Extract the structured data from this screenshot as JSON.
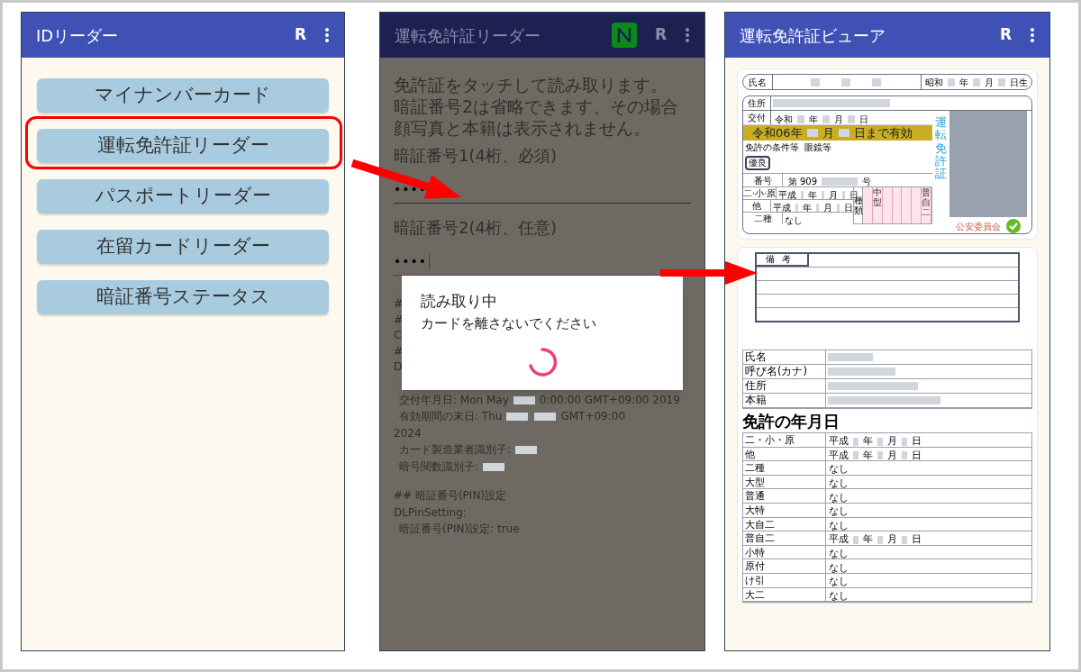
{
  "menu_screen": {
    "title": "IDリーダー",
    "action": "R",
    "buttons": [
      {
        "label": "マイナンバーカード",
        "highlighted": false
      },
      {
        "label": "運転免許証リーダー",
        "highlighted": true
      },
      {
        "label": "パスポートリーダー",
        "highlighted": false
      },
      {
        "label": "在留カードリーダー",
        "highlighted": false
      },
      {
        "label": "暗証番号ステータス",
        "highlighted": false
      }
    ]
  },
  "reader_screen": {
    "title": "運転免許証リーダー",
    "action": "R",
    "nfc_on": true,
    "instructions": [
      "免許証をタッチして読み取ります。",
      "暗証番号2は省略できます、その場合",
      "顔写真と本籍は表示されません。"
    ],
    "fields": [
      {
        "label": "暗証番号1(4桁、必須)",
        "value": "••••",
        "focused": false
      },
      {
        "label": "暗証番号2(4桁、任意)",
        "value": "••••",
        "focused": true
      }
    ],
    "log_fragments": [
      "#",
      "#",
      "C",
      "#",
      "D"
    ],
    "log": [
      {
        "kind": "entry",
        "segments": [
          {
            "kind": "text",
            "text": "交付年月日: Mon May"
          },
          {
            "kind": "redacted"
          },
          {
            "kind": "text",
            "text": "0:00:00 GMT+09:00 2019"
          }
        ]
      },
      {
        "kind": "entry",
        "segments": [
          {
            "kind": "text",
            "text": "有効期間の末日: Thu"
          },
          {
            "kind": "redacted"
          },
          {
            "kind": "redacted"
          },
          {
            "kind": "text",
            "text": "GMT+09:00"
          }
        ]
      },
      {
        "kind": "plain",
        "segments": [
          {
            "kind": "text",
            "text": "2024"
          }
        ]
      },
      {
        "kind": "entry",
        "segments": [
          {
            "kind": "text",
            "text": "カード製造業者識別子:"
          },
          {
            "kind": "redacted"
          }
        ]
      },
      {
        "kind": "entry",
        "segments": [
          {
            "kind": "text",
            "text": "暗号関数識別子:"
          },
          {
            "kind": "redacted"
          }
        ]
      },
      {
        "kind": "heading",
        "segments": [
          {
            "kind": "text",
            "text": "## 暗証番号(PIN)設定"
          }
        ]
      },
      {
        "kind": "plain",
        "segments": [
          {
            "kind": "text",
            "text": "DLPinSetting:"
          }
        ]
      },
      {
        "kind": "entry",
        "segments": [
          {
            "kind": "text",
            "text": "暗証番号(PIN)設定: true"
          }
        ]
      }
    ],
    "dialog": {
      "title": "読み取り中",
      "message": "カードを離さないでください"
    }
  },
  "viewer_screen": {
    "title": "運転免許証ビューア",
    "action": "R",
    "license_card": {
      "name_label": "氏名",
      "birth": [
        {
          "kind": "text",
          "text": "昭和"
        },
        {
          "kind": "redacted"
        },
        {
          "kind": "text",
          "text": "年"
        },
        {
          "kind": "redacted"
        },
        {
          "kind": "text",
          "text": "月"
        },
        {
          "kind": "redacted"
        },
        {
          "kind": "text",
          "text": "日生"
        }
      ],
      "address_label": "住所",
      "issue_label": "交付",
      "issue_value": [
        {
          "kind": "text",
          "text": "令和"
        },
        {
          "kind": "redacted"
        },
        {
          "kind": "text",
          "text": "年"
        },
        {
          "kind": "redacted"
        },
        {
          "kind": "text",
          "text": "月"
        },
        {
          "kind": "redacted"
        },
        {
          "kind": "text",
          "text": "日"
        }
      ],
      "validity": [
        {
          "kind": "text",
          "text": "令和06年"
        },
        {
          "kind": "redacted"
        },
        {
          "kind": "text",
          "text": "月"
        },
        {
          "kind": "redacted"
        },
        {
          "kind": "text",
          "text": "日まで有効"
        }
      ],
      "conditions_label": "免許の条件等",
      "conditions_value": "眼鏡等",
      "badge": "優良",
      "number_label": "番号",
      "number_value": [
        {
          "kind": "text",
          "text": "第"
        },
        {
          "kind": "text",
          "text": "909"
        },
        {
          "kind": "redacted"
        },
        {
          "kind": "text",
          "text": "号"
        }
      ],
      "dates": [
        {
          "label": "二·小·原",
          "value": [
            {
              "kind": "text",
              "text": "平成"
            },
            {
              "kind": "redacted"
            },
            {
              "kind": "text",
              "text": "年"
            },
            {
              "kind": "redacted"
            },
            {
              "kind": "text",
              "text": "月"
            },
            {
              "kind": "redacted"
            },
            {
              "kind": "text",
              "text": "日"
            }
          ]
        },
        {
          "label": "他",
          "value": [
            {
              "kind": "text",
              "text": "平成"
            },
            {
              "kind": "redacted"
            },
            {
              "kind": "text",
              "text": "年"
            },
            {
              "kind": "redacted"
            },
            {
              "kind": "text",
              "text": "月"
            },
            {
              "kind": "redacted"
            },
            {
              "kind": "text",
              "text": "日"
            }
          ]
        },
        {
          "label": "二種",
          "value": [
            {
              "kind": "text",
              "text": "なし"
            }
          ]
        }
      ],
      "class_label": "種類",
      "class_columns": [
        {
          "kind": "blank"
        },
        {
          "kind": "labelled",
          "label": "中型"
        },
        {
          "kind": "blank"
        },
        {
          "kind": "blank"
        },
        {
          "kind": "blank"
        },
        {
          "kind": "blank"
        },
        {
          "kind": "labelled",
          "label": "普自二"
        }
      ],
      "card_type": "運転免許証",
      "authority": "公安委員会",
      "verified": true
    },
    "remarks": {
      "label": "備考"
    },
    "personal_table": [
      {
        "label": "氏名"
      },
      {
        "label": "呼び名(カナ)"
      },
      {
        "label": "住所"
      },
      {
        "label": "本籍"
      }
    ],
    "dates_heading": "免許の年月日",
    "dates_table": [
      {
        "label": "二・小・原",
        "value": [
          {
            "kind": "text",
            "text": "平成"
          },
          {
            "kind": "redacted"
          },
          {
            "kind": "text",
            "text": "年"
          },
          {
            "kind": "redacted"
          },
          {
            "kind": "text",
            "text": "月"
          },
          {
            "kind": "redacted"
          },
          {
            "kind": "text",
            "text": "日"
          }
        ]
      },
      {
        "label": "他",
        "value": [
          {
            "kind": "text",
            "text": "平成"
          },
          {
            "kind": "redacted"
          },
          {
            "kind": "text",
            "text": "年"
          },
          {
            "kind": "redacted"
          },
          {
            "kind": "text",
            "text": "月"
          },
          {
            "kind": "redacted"
          },
          {
            "kind": "text",
            "text": "日"
          }
        ]
      },
      {
        "label": "二種",
        "value": [
          {
            "kind": "text",
            "text": "なし"
          }
        ]
      },
      {
        "label": "大型",
        "value": [
          {
            "kind": "text",
            "text": "なし"
          }
        ]
      },
      {
        "label": "普通",
        "value": [
          {
            "kind": "text",
            "text": "なし"
          }
        ]
      },
      {
        "label": "大特",
        "value": [
          {
            "kind": "text",
            "text": "なし"
          }
        ]
      },
      {
        "label": "大自二",
        "value": [
          {
            "kind": "text",
            "text": "なし"
          }
        ]
      },
      {
        "label": "普自二",
        "value": [
          {
            "kind": "text",
            "text": "平成"
          },
          {
            "kind": "redacted"
          },
          {
            "kind": "text",
            "text": "年"
          },
          {
            "kind": "redacted"
          },
          {
            "kind": "text",
            "text": "月"
          },
          {
            "kind": "redacted"
          },
          {
            "kind": "text",
            "text": "日"
          }
        ]
      },
      {
        "label": "小特",
        "value": [
          {
            "kind": "text",
            "text": "なし"
          }
        ]
      },
      {
        "label": "原付",
        "value": [
          {
            "kind": "text",
            "text": "なし"
          }
        ]
      },
      {
        "label": "け引",
        "value": [
          {
            "kind": "text",
            "text": "なし"
          }
        ]
      },
      {
        "label": "大二",
        "value": [
          {
            "kind": "text",
            "text": "なし"
          }
        ]
      }
    ]
  }
}
